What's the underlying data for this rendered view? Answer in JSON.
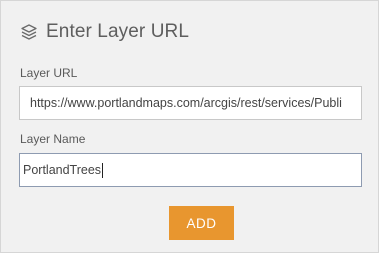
{
  "header": {
    "icon": "layers-icon",
    "title": "Enter Layer URL"
  },
  "form": {
    "layer_url_label": "Layer URL",
    "layer_url_value": "https://www.portlandmaps.com/arcgis/rest/services/Publi",
    "layer_name_label": "Layer Name",
    "layer_name_value": "PortlandTrees"
  },
  "actions": {
    "add_label": "ADD"
  },
  "colors": {
    "accent": "#e8962f",
    "panel_bg": "#f1f1f1",
    "focus_border": "#8e9bb1"
  }
}
